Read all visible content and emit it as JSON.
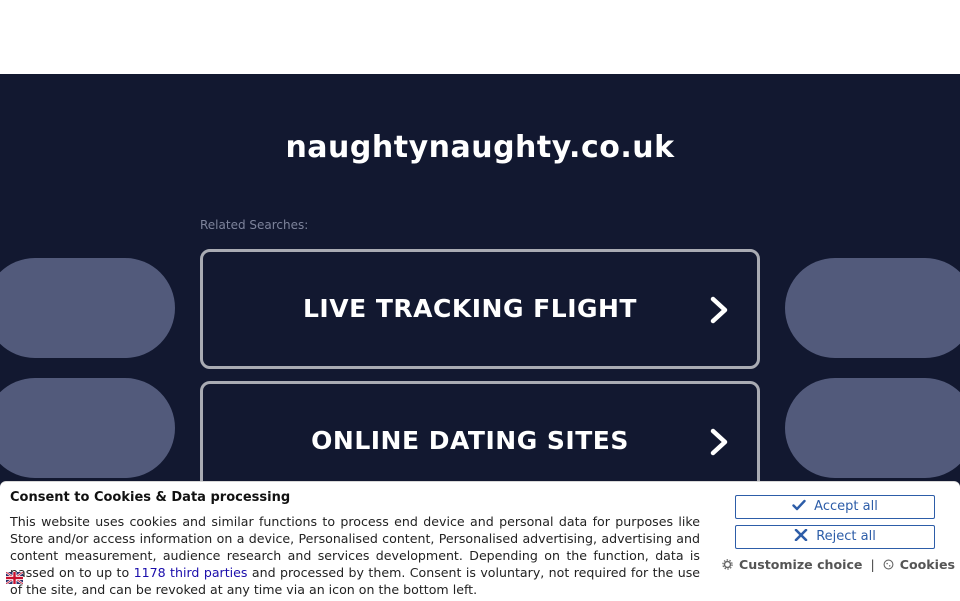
{
  "site": {
    "title": "naughtynaughty.co.uk"
  },
  "related": {
    "label": "Related Searches:",
    "items": [
      {
        "label": "LIVE TRACKING FLIGHT"
      },
      {
        "label": "ONLINE DATING SITES"
      }
    ]
  },
  "consent": {
    "title": "Consent to Cookies & Data processing",
    "text_before": "This website uses cookies and similar functions to process end device and personal data for purposes like Store and/or access information on a device, Personalised content, Personalised advertising, advertising and content measurement, audience research and services development. Depending on the function, data is passed on to up to ",
    "link": "1178 third parties",
    "text_after": " and processed by them. Consent is voluntary, not required for the use of the site, and can be revoked at any time via an icon on the bottom left.",
    "accept_label": "Accept all",
    "reject_label": "Reject all",
    "customize_label": "Customize choice",
    "separator": "|",
    "cookies_label": "Cookies"
  },
  "colors": {
    "background": "#121830",
    "decor": "#525a7b",
    "box_border": "#a9abb3",
    "button_accent": "#2d5da8"
  }
}
